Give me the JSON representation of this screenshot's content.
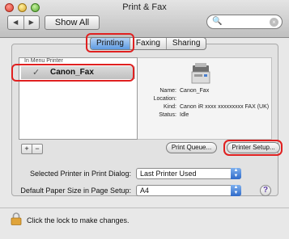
{
  "window": {
    "title": "Print & Fax"
  },
  "toolbar": {
    "back_glyph": "◀",
    "forward_glyph": "▶",
    "show_all_label": "Show All",
    "search": {
      "value": "",
      "placeholder": ""
    }
  },
  "tabs": [
    {
      "label": "Printing",
      "active": true
    },
    {
      "label": "Faxing",
      "active": false
    },
    {
      "label": "Sharing",
      "active": false
    }
  ],
  "printer_list": {
    "header": "In Menu  Printer",
    "items": [
      {
        "checked": true,
        "check_glyph": "✓",
        "name": "Canon_Fax",
        "selected": true
      }
    ]
  },
  "details": [
    {
      "key": "Name:",
      "value": "Canon_Fax"
    },
    {
      "key": "Location:",
      "value": ""
    },
    {
      "key": "Kind:",
      "value": "Canon iR xxxx xxxxxxxxx FAX (UK)"
    },
    {
      "key": "Status:",
      "value": "Idle"
    }
  ],
  "list_controls": {
    "add": "+",
    "remove": "−"
  },
  "buttons": {
    "print_queue": "Print Queue...",
    "printer_setup": "Printer Setup..."
  },
  "form": {
    "selected_printer": {
      "label": "Selected Printer in Print Dialog:",
      "value": "Last Printer Used"
    },
    "paper_size": {
      "label": "Default Paper Size in Page Setup:",
      "value": "A4"
    },
    "help_glyph": "?"
  },
  "lock": {
    "text": "Click the lock to make changes."
  },
  "colors": {
    "highlight": "#e02020",
    "selection_blue": "#5d9ae2"
  }
}
